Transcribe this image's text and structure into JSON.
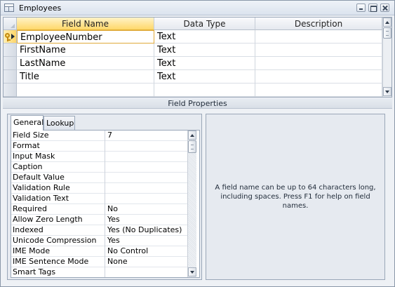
{
  "window": {
    "title": "Employees",
    "icon": "table-icon"
  },
  "grid": {
    "columns": [
      "Field Name",
      "Data Type",
      "Description"
    ],
    "rows": [
      {
        "field_name": "EmployeeNumber",
        "data_type": "Text",
        "description": "",
        "primary_key": true
      },
      {
        "field_name": "FirstName",
        "data_type": "Text",
        "description": ""
      },
      {
        "field_name": "LastName",
        "data_type": "Text",
        "description": ""
      },
      {
        "field_name": "Title",
        "data_type": "Text",
        "description": ""
      },
      {
        "field_name": "",
        "data_type": "",
        "description": ""
      }
    ]
  },
  "field_properties": {
    "label": "Field Properties",
    "tabs": [
      "General",
      "Lookup"
    ],
    "active_tab": "General",
    "rows": [
      {
        "name": "Field Size",
        "value": "7"
      },
      {
        "name": "Format",
        "value": ""
      },
      {
        "name": "Input Mask",
        "value": ""
      },
      {
        "name": "Caption",
        "value": ""
      },
      {
        "name": "Default Value",
        "value": ""
      },
      {
        "name": "Validation Rule",
        "value": ""
      },
      {
        "name": "Validation Text",
        "value": ""
      },
      {
        "name": "Required",
        "value": "No"
      },
      {
        "name": "Allow Zero Length",
        "value": "Yes"
      },
      {
        "name": "Indexed",
        "value": "Yes (No Duplicates)"
      },
      {
        "name": "Unicode Compression",
        "value": "Yes"
      },
      {
        "name": "IME Mode",
        "value": "No Control"
      },
      {
        "name": "IME Sentence Mode",
        "value": "None"
      },
      {
        "name": "Smart Tags",
        "value": ""
      }
    ]
  },
  "help": {
    "text": "A field name can be up to 64 characters long, including spaces. Press F1 for help on field names."
  }
}
